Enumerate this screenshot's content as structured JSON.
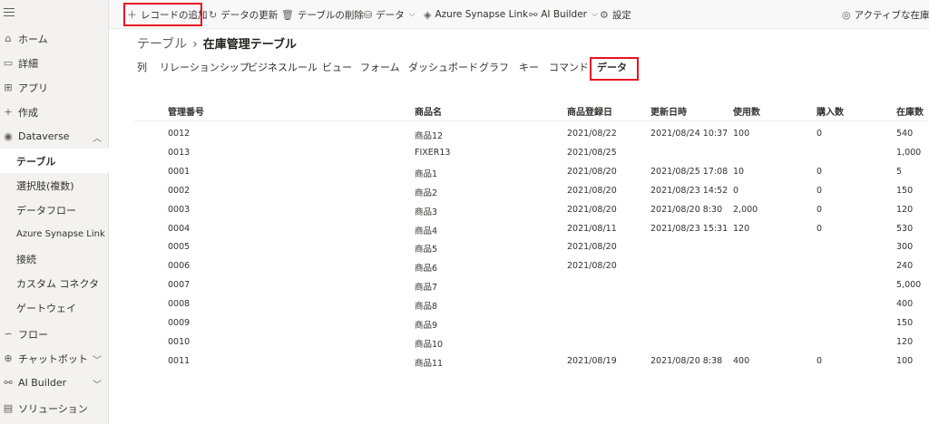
{
  "sidebar": {
    "items": [
      {
        "label": "ホーム",
        "icon": "home-icon"
      },
      {
        "label": "詳細",
        "icon": "book-icon"
      },
      {
        "label": "アプリ",
        "icon": "apps-icon"
      },
      {
        "label": "作成",
        "icon": "plus-icon"
      },
      {
        "label": "Dataverse",
        "icon": "database-icon"
      },
      {
        "label": "テーブル"
      },
      {
        "label": "選択肢(複数)"
      },
      {
        "label": "データフロー"
      },
      {
        "label": "Azure Synapse Link"
      },
      {
        "label": "接続"
      },
      {
        "label": "カスタム コネクタ"
      },
      {
        "label": "ゲートウェイ"
      },
      {
        "label": "フロー",
        "icon": "flow-icon"
      },
      {
        "label": "チャットボット",
        "icon": "bot-icon"
      },
      {
        "label": "AI Builder",
        "icon": "ai-builder-icon"
      },
      {
        "label": "ソリューション",
        "icon": "solution-icon"
      }
    ]
  },
  "toolbar": {
    "add_record": "レコードの追加",
    "refresh": "データの更新",
    "delete_table": "テーブルの削除",
    "data": "データ",
    "synapse": "Azure Synapse Link",
    "ai_builder": "AI Builder",
    "settings": "設定",
    "active": "アクティブな在庫管"
  },
  "breadcrumb": {
    "parent": "テーブル",
    "separator": "›",
    "current": "在庫管理テーブル"
  },
  "tabs": [
    "列",
    "リレーションシップ",
    "ビジネスルール",
    "ビュー",
    "フォーム",
    "ダッシュボード",
    "グラフ",
    "キー",
    "コマンド",
    "データ"
  ],
  "table": {
    "columns": [
      "管理番号",
      "商品名",
      "商品登録日",
      "更新日時",
      "使用数",
      "購入数",
      "在庫数"
    ],
    "rows": [
      [
        "0012",
        "商品12",
        "2021/08/22",
        "2021/08/24 10:37",
        "100",
        "0",
        "540"
      ],
      [
        "0013",
        "FIXER13",
        "2021/08/25",
        "",
        "",
        "",
        "1,000"
      ],
      [
        "0001",
        "商品1",
        "2021/08/20",
        "2021/08/25 17:08",
        "10",
        "0",
        "5"
      ],
      [
        "0002",
        "商品2",
        "2021/08/20",
        "2021/08/23 14:52",
        "0",
        "0",
        "150"
      ],
      [
        "0003",
        "商品3",
        "2021/08/20",
        "2021/08/20 8:30",
        "2,000",
        "0",
        "120"
      ],
      [
        "0004",
        "商品4",
        "2021/08/11",
        "2021/08/23 15:31",
        "120",
        "0",
        "530"
      ],
      [
        "0005",
        "商品5",
        "2021/08/20",
        "",
        "",
        "",
        "300"
      ],
      [
        "0006",
        "商品6",
        "2021/08/20",
        "",
        "",
        "",
        "240"
      ],
      [
        "0007",
        "商品7",
        "",
        "",
        "",
        "",
        "5,000"
      ],
      [
        "0008",
        "商品8",
        "",
        "",
        "",
        "",
        "400"
      ],
      [
        "0009",
        "商品9",
        "",
        "",
        "",
        "",
        "150"
      ],
      [
        "0010",
        "商品10",
        "",
        "",
        "",
        "",
        "120"
      ],
      [
        "0011",
        "商品11",
        "2021/08/19",
        "2021/08/20 8:38",
        "400",
        "0",
        "100"
      ]
    ]
  },
  "colors": {
    "highlight": "#e81123",
    "sidebar_bg": "#f3f2f1"
  }
}
